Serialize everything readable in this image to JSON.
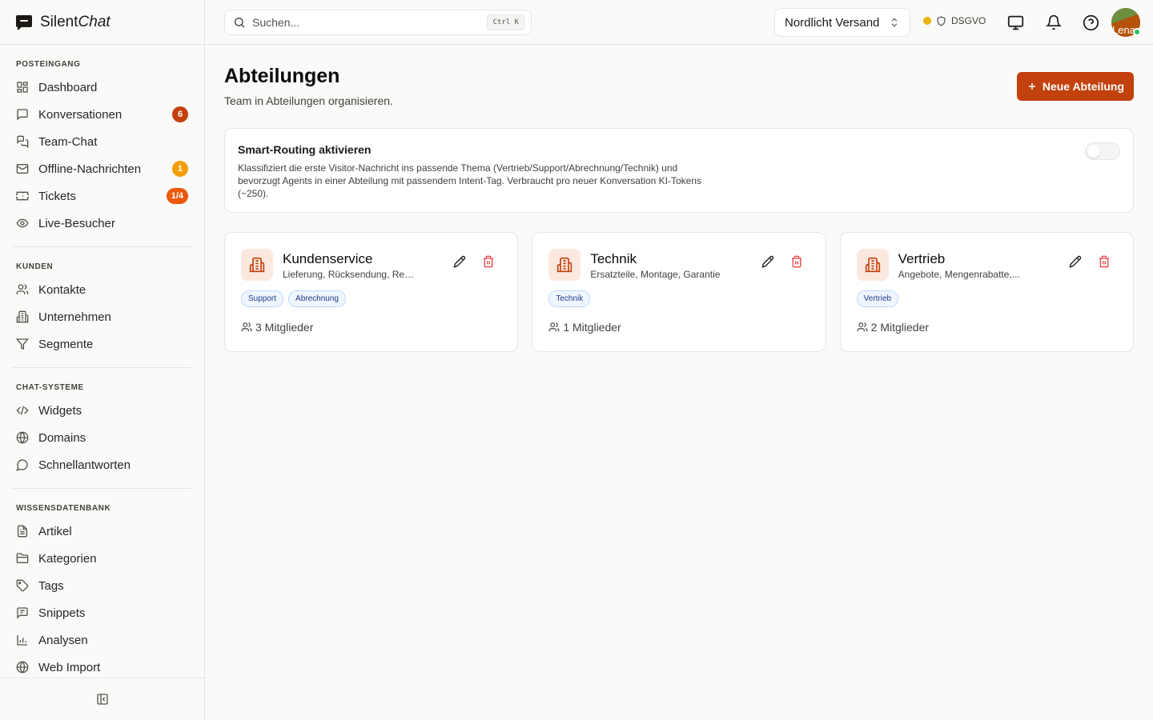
{
  "app": {
    "name_part1": "Silent",
    "name_part2": "Chat"
  },
  "sidebar": {
    "sections": [
      {
        "title": "POSTEINGANG",
        "items": [
          {
            "label": "Dashboard",
            "icon": "grid-icon"
          },
          {
            "label": "Konversationen",
            "icon": "message-square-icon",
            "badge": "6"
          },
          {
            "label": "Team-Chat",
            "icon": "messages-icon"
          },
          {
            "label": "Offline-Nachrichten",
            "icon": "mail-icon",
            "badge": "1"
          },
          {
            "label": "Tickets",
            "icon": "ticket-icon",
            "badge": "1/4"
          },
          {
            "label": "Live-Besucher",
            "icon": "eye-icon"
          }
        ]
      },
      {
        "title": "KUNDEN",
        "items": [
          {
            "label": "Kontakte",
            "icon": "users-icon"
          },
          {
            "label": "Unternehmen",
            "icon": "building-icon"
          },
          {
            "label": "Segmente",
            "icon": "filter-icon"
          }
        ]
      },
      {
        "title": "CHAT-SYSTEME",
        "items": [
          {
            "label": "Widgets",
            "icon": "code-icon"
          },
          {
            "label": "Domains",
            "icon": "globe-icon"
          },
          {
            "label": "Schnellantworten",
            "icon": "message-circle-icon"
          }
        ]
      },
      {
        "title": "WISSENSDATENBANK",
        "items": [
          {
            "label": "Artikel",
            "icon": "file-text-icon"
          },
          {
            "label": "Kategorien",
            "icon": "folder-icon"
          },
          {
            "label": "Tags",
            "icon": "tag-icon"
          },
          {
            "label": "Snippets",
            "icon": "message-lines-icon"
          },
          {
            "label": "Analysen",
            "icon": "bar-chart-icon"
          },
          {
            "label": "Web Import",
            "icon": "globe-icon"
          }
        ]
      }
    ]
  },
  "topbar": {
    "search_placeholder": "Suchen...",
    "search_shortcut": "Ctrl K",
    "org": "Nordlicht Versand",
    "gdpr_label": "DSGVO",
    "avatar_text": "Lena"
  },
  "page": {
    "title": "Abteilungen",
    "subtitle": "Team in Abteilungen organisieren.",
    "new_button": "Neue Abteilung"
  },
  "routing": {
    "title": "Smart-Routing aktivieren",
    "description": "Klassifiziert die erste Visitor-Nachricht ins passende Thema (Vertrieb/Support/Abrechnung/Technik) und bevorzugt Agents in einer Abteilung mit passendem Intent-Tag. Verbraucht pro neuer Konversation KI-Tokens (~250).",
    "enabled": false
  },
  "departments": [
    {
      "name": "Kundenservice",
      "description": "Lieferung, Rücksendung, Rechnung",
      "tags": [
        "Support",
        "Abrechnung"
      ],
      "members": "3 Mitglieder"
    },
    {
      "name": "Technik",
      "description": "Ersatzteile, Montage, Garantie",
      "tags": [
        "Technik"
      ],
      "members": "1 Mitglieder"
    },
    {
      "name": "Vertrieb",
      "description": "Angebote, Mengenrabatte,...",
      "tags": [
        "Vertrieb"
      ],
      "members": "2 Mitglieder"
    }
  ],
  "colors": {
    "accent": "#c2410c",
    "badge_amber": "#f59e0b",
    "badge_orange": "#ea580c",
    "status_online": "#22c55e",
    "status_gdpr": "#eab308"
  }
}
